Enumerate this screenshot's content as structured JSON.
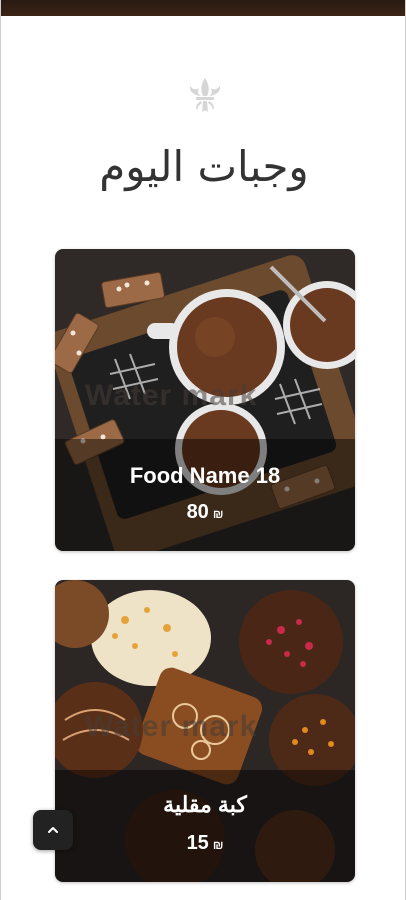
{
  "section": {
    "title": "وجبات اليوم"
  },
  "cards": [
    {
      "name": "Food Name 18",
      "price": "80",
      "currency": "₪",
      "watermark": "Water mark"
    },
    {
      "name": "كبة مقلية",
      "price": "15",
      "currency": "₪",
      "watermark": "Water mark"
    }
  ],
  "icons": {
    "ornament": "fleur-de-lis-icon",
    "scroll_top": "chevron-up-icon"
  },
  "colors": {
    "top_strip": "#2a1a12",
    "title": "#333333",
    "ornament": "#d9d9d9",
    "scroll_button": "#222222"
  }
}
